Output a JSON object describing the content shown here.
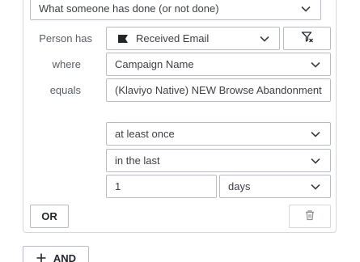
{
  "condition": {
    "type_select": "What someone has done (or not done)",
    "person_has_label": "Person has",
    "metric_select": "Received Email",
    "where_label": "where",
    "property_select": "Campaign Name",
    "equals_label": "equals",
    "value_input": "(Klaviyo Native) NEW Browse Abandonment:",
    "frequency_select": "at least once",
    "timeframe_select": "in the last",
    "count_input": "1",
    "unit_select": "days",
    "or_button": "OR",
    "and_button": "AND"
  },
  "colors": {
    "border": "#b7bbc2",
    "panel_border": "#d6d8dc",
    "text": "#3c3f45",
    "label": "#5a5e66"
  },
  "icons": {
    "chevron": "chevron-down-icon",
    "filter": "filter-remove-icon",
    "trash": "trash-icon",
    "plus": "plus-icon",
    "flag": "email-flag-icon"
  }
}
